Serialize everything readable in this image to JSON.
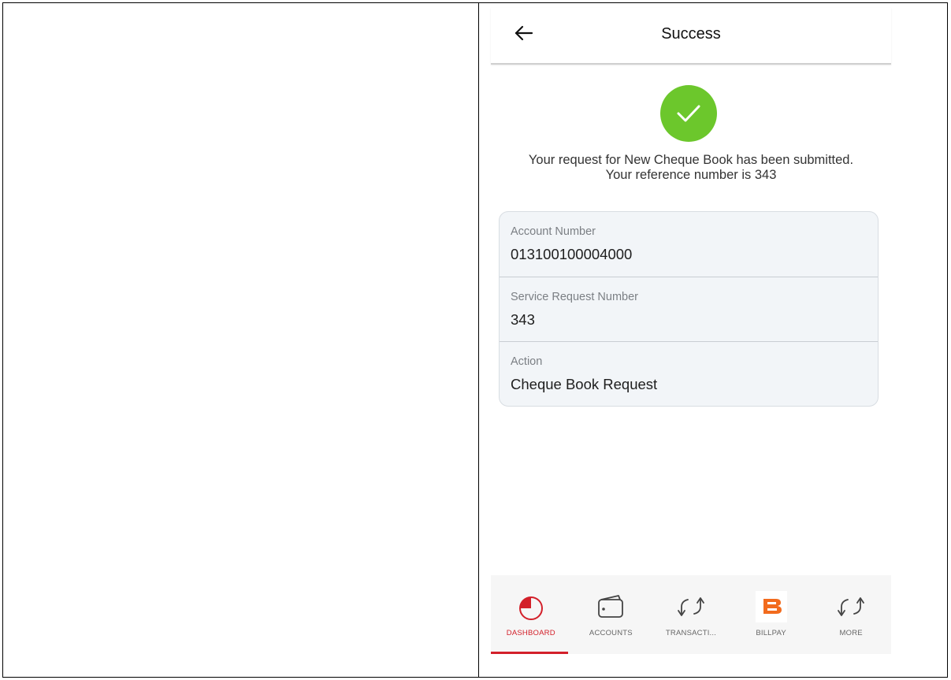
{
  "appbar": {
    "title": "Success",
    "back_icon": "arrow-left-icon"
  },
  "status": {
    "icon": "check-circle-icon",
    "color": "#6cc72c",
    "message": "Your request for New Cheque Book has been submitted. Your reference number is 343"
  },
  "details": [
    {
      "label": "Account Number",
      "value": "013100100004000"
    },
    {
      "label": "Service Request Number",
      "value": "343"
    },
    {
      "label": "Action",
      "value": "Cheque Book Request"
    }
  ],
  "nav": {
    "active_color": "#d3202a",
    "items": [
      {
        "label": "DASHBOARD",
        "icon": "dashboard-pie-icon",
        "active": true
      },
      {
        "label": "ACCOUNTS",
        "icon": "wallet-icon",
        "active": false
      },
      {
        "label": "TRANSACTI...",
        "icon": "transfer-arrows-icon",
        "active": false
      },
      {
        "label": "BILLPAY",
        "icon": "billpay-logo-icon",
        "active": false
      },
      {
        "label": "MORE",
        "icon": "transfer-arrows-icon",
        "active": false
      }
    ]
  }
}
